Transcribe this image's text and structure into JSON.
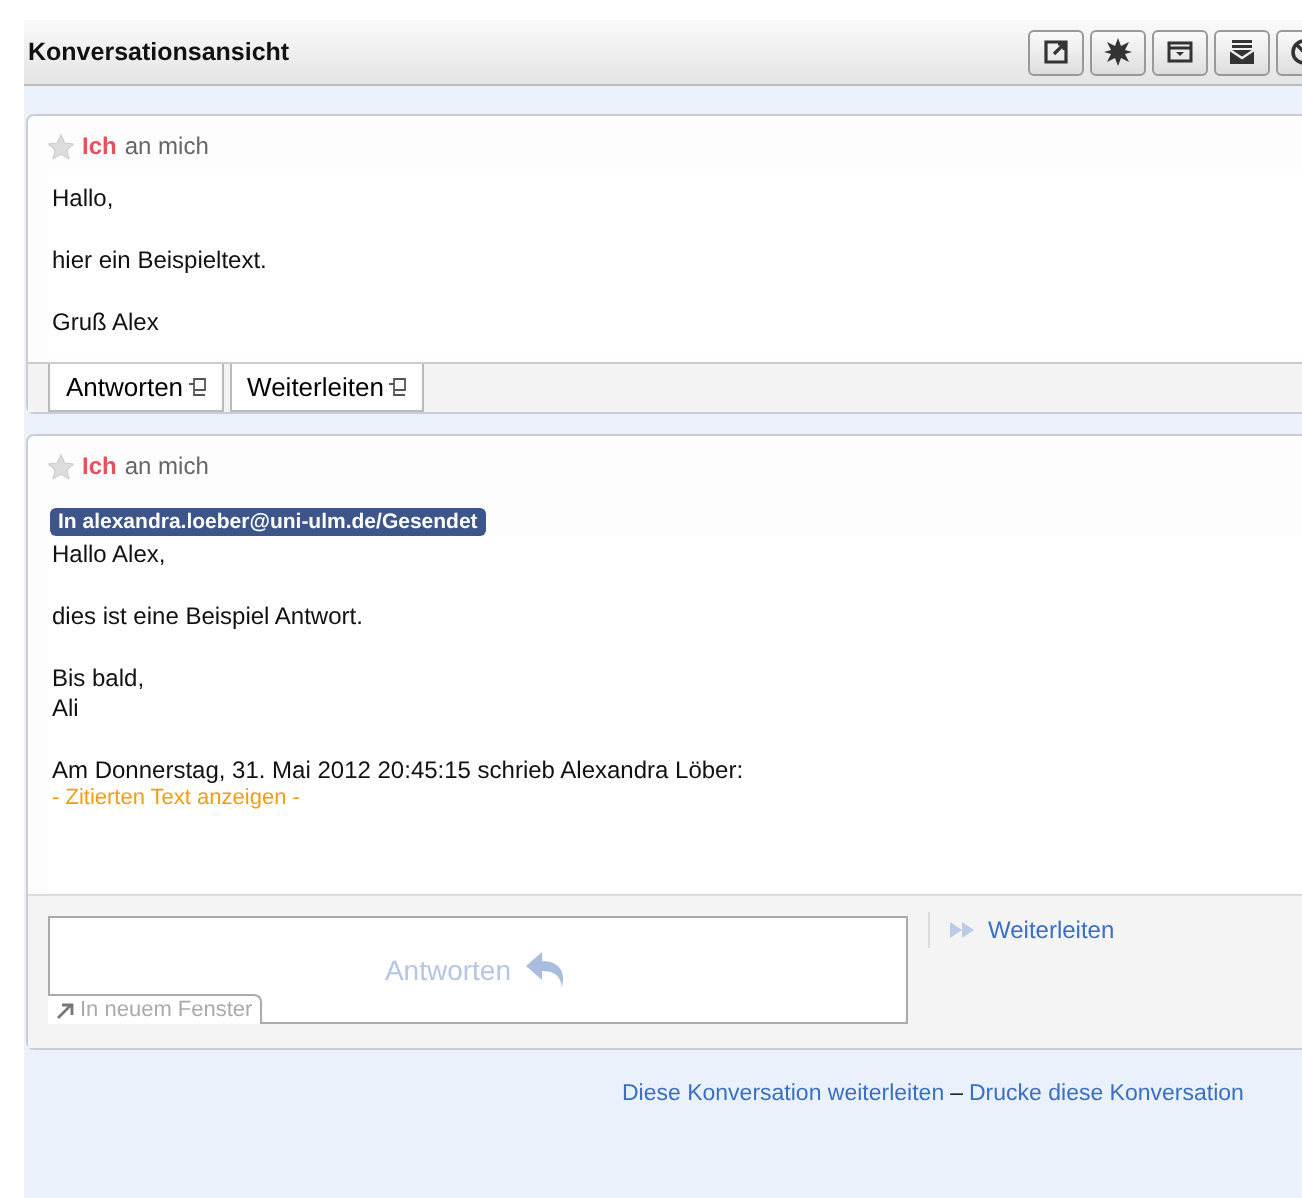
{
  "header": {
    "title": "Konversationsansicht",
    "tools": [
      {
        "kind": "popout"
      },
      {
        "kind": "burst"
      },
      {
        "kind": "archive"
      },
      {
        "kind": "inbox"
      },
      {
        "kind": "block"
      }
    ]
  },
  "messages": [
    {
      "starred": false,
      "sender": "Ich",
      "recipient": "an mich",
      "paragraphs": [
        "Hallo,",
        "hier ein Beispieltext.",
        "Gruß Alex"
      ],
      "actions": [
        "Antworten",
        "Weiterleiten"
      ]
    },
    {
      "starred": false,
      "sender": "Ich",
      "recipient": "an mich",
      "folder": "In alexandra.loeber@uni-ulm.de/Gesendet",
      "paragraphs": [
        "Hallo Alex,",
        "dies ist eine Beispiel Antwort.",
        "Bis bald,\nAli",
        "Am Donnerstag, 31. Mai 2012 20:45:15 schrieb Alexandra Löber:"
      ],
      "quote_toggle": "- Zitierten Text anzeigen -"
    }
  ],
  "reply": {
    "label": "Antworten",
    "new_window": "In neuem Fenster",
    "forward": "Weiterleiten"
  },
  "footer": {
    "links": [
      "Diese Konversation weiterleiten",
      "Drucke diese Konversation"
    ],
    "separator": "–"
  }
}
